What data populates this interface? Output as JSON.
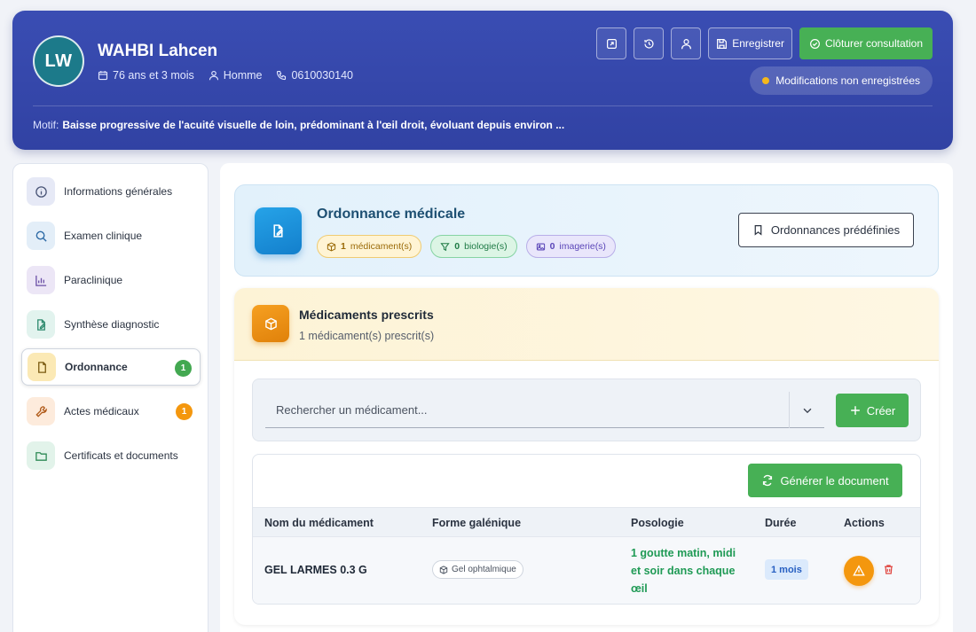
{
  "patient": {
    "initials": "LW",
    "name": "WAHBI Lahcen",
    "age": "76 ans et 3 mois",
    "sex": "Homme",
    "phone": "0610030140",
    "motif_label": "Motif:",
    "motif_text": "Baisse progressive de l'acuité visuelle de loin, prédominant à l'œil droit, évoluant depuis environ ..."
  },
  "header": {
    "save_label": "Enregistrer",
    "close_label": "Clôturer consultation",
    "unsaved_label": "Modifications non enregistrées"
  },
  "sidebar": {
    "items": [
      {
        "label": "Informations générales",
        "icon": "info-icon",
        "badge": ""
      },
      {
        "label": "Examen clinique",
        "icon": "search-icon",
        "badge": ""
      },
      {
        "label": "Paraclinique",
        "icon": "chart-icon",
        "badge": ""
      },
      {
        "label": "Synthèse diagnostic",
        "icon": "edit-document-icon",
        "badge": ""
      },
      {
        "label": "Ordonnance",
        "icon": "document-icon",
        "badge": "1"
      },
      {
        "label": "Actes médicaux",
        "icon": "wrench-icon",
        "badge": "1"
      },
      {
        "label": "Certificats et documents",
        "icon": "folder-icon",
        "badge": ""
      }
    ]
  },
  "ordonnance": {
    "title": "Ordonnance médicale",
    "chips": {
      "med_count": "1",
      "med_label": "médicament(s)",
      "bio_count": "0",
      "bio_label": "biologie(s)",
      "img_count": "0",
      "img_label": "imagerie(s)"
    },
    "predef_label": "Ordonnances prédéfinies"
  },
  "medicaments": {
    "title": "Médicaments prescrits",
    "subtitle": "1 médicament(s) prescrit(s)",
    "search_placeholder": "Rechercher un médicament...",
    "create_label": "Créer",
    "generate_label": "Générer le document",
    "columns": [
      "Nom du médicament",
      "Forme galénique",
      "Posologie",
      "Durée",
      "Actions"
    ],
    "rows": [
      {
        "name": "GEL LARMES 0.3 G",
        "form": "Gel ophtalmique",
        "posologie": "1 goutte matin, midi et soir dans chaque œil",
        "duree": "1 mois"
      }
    ]
  },
  "colors": {
    "header_bg": "#3446a8",
    "accent_green": "#47b055",
    "accent_orange": "#f4970e",
    "ord_blue": "#1d4f72"
  }
}
